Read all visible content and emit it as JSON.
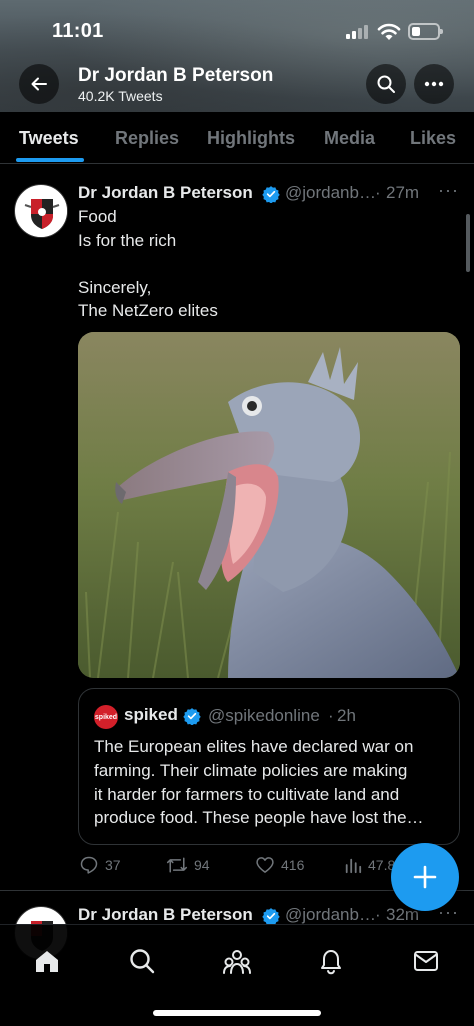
{
  "status_bar": {
    "time": "11:01"
  },
  "header": {
    "name": "Dr Jordan B Peterson",
    "tweet_count": "40.2K Tweets",
    "icons": {
      "back": "back-arrow-icon",
      "search": "search-icon",
      "more": "more-horizontal-icon"
    }
  },
  "tabs": [
    {
      "label": "Tweets",
      "active": true
    },
    {
      "label": "Replies",
      "active": false
    },
    {
      "label": "Highlights",
      "active": false
    },
    {
      "label": "Media",
      "active": false
    },
    {
      "label": "Likes",
      "active": false
    }
  ],
  "tweet1": {
    "author": "Dr Jordan B Peterson",
    "handle": "@jordanb…",
    "time": "27m",
    "separator": "·",
    "text_lines": [
      "Food",
      "Is for the rich",
      "",
      "Sincerely,",
      "The NetZero elites"
    ],
    "media_description": "shoebill-bird-photo",
    "quote": {
      "logo_text": "spiked",
      "author": "spiked",
      "handle": "@spikedonline",
      "time": "2h",
      "text_lines": [
        "The European elites have declared war on",
        "farming. Their climate policies are making",
        "it harder for farmers to cultivate land and",
        "produce food. These people have lost the…"
      ]
    },
    "actions": {
      "replies": "37",
      "retweets": "94",
      "likes": "416",
      "views": "47.8"
    }
  },
  "tweet2": {
    "author": "Dr Jordan B Peterson",
    "handle": "@jordanb…",
    "time": "32m",
    "separator": "·"
  },
  "bottom_nav": [
    "home-icon",
    "search-icon",
    "communities-icon",
    "notifications-icon",
    "messages-icon"
  ],
  "colors": {
    "accent": "#1d9bf0",
    "background": "#000000",
    "muted": "#71767b",
    "text": "#e7e9ea"
  }
}
